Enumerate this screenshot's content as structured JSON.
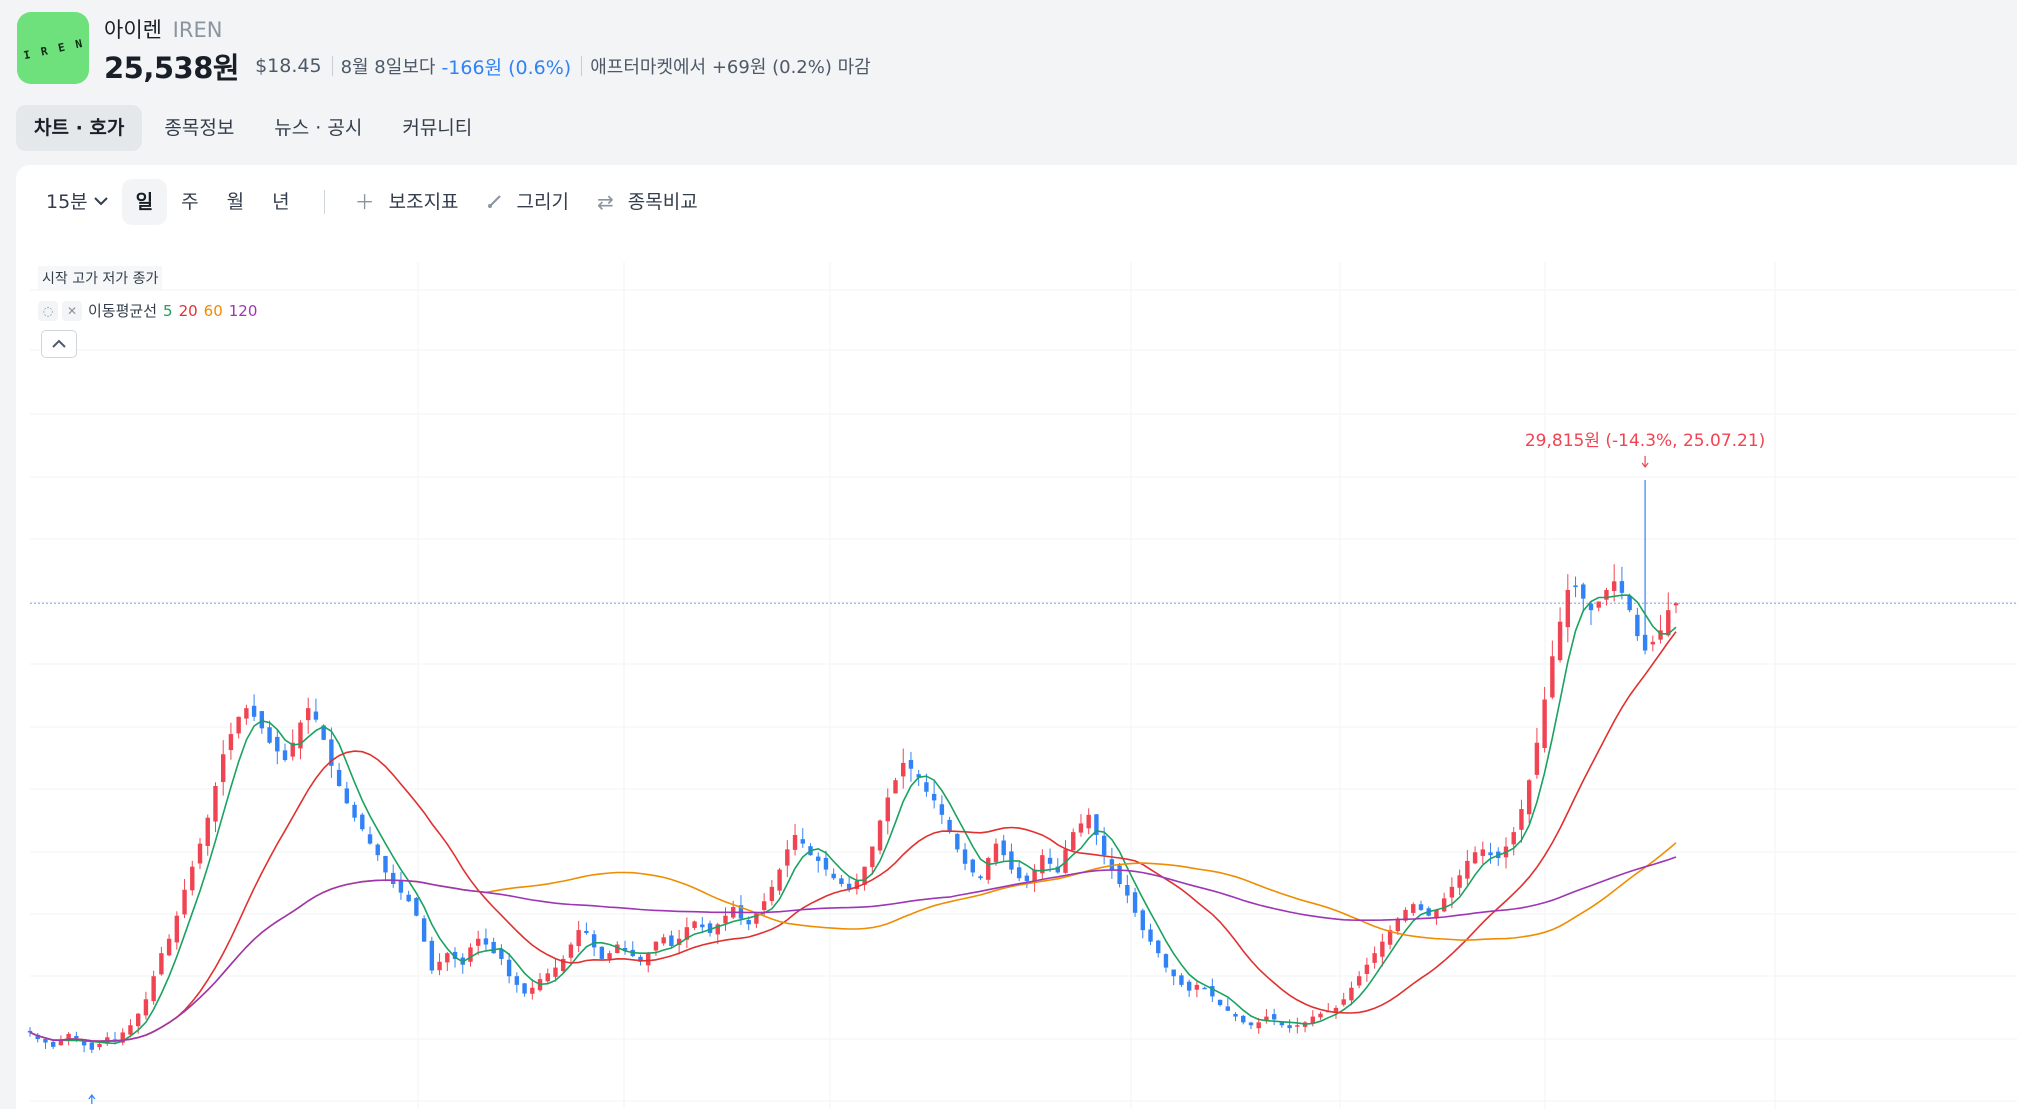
{
  "header": {
    "logo_text": "IREN",
    "name": "아이렌",
    "ticker": "IREN",
    "price": "25,538원",
    "usd": "$18.45",
    "compare_label": "8월 8일보다",
    "change": "-166원 (0.6%)",
    "after_market": "애프터마켓에서 +69원 (0.2%) 마감"
  },
  "tabs": [
    {
      "label": "차트 · 호가"
    },
    {
      "label": "종목정보"
    },
    {
      "label": "뉴스 · 공시"
    },
    {
      "label": "커뮤니티"
    }
  ],
  "toolbar": {
    "interval": "15분",
    "periods": [
      "일",
      "주",
      "월",
      "년"
    ],
    "indicator": "보조지표",
    "draw": "그리기",
    "compare": "종목비교"
  },
  "legend": {
    "ohlc": "시작 고가 저가 종가",
    "ma_label": "이동평균선",
    "ma": [
      {
        "period": "5",
        "color": "#1aa260"
      },
      {
        "period": "20",
        "color": "#e03131"
      },
      {
        "period": "60",
        "color": "#f08c00"
      },
      {
        "period": "120",
        "color": "#9c36b5"
      }
    ]
  },
  "colors": {
    "up": "#f04452",
    "down": "#3182f6",
    "accent": "#3182f6",
    "logo_bg": "#6ee07c"
  },
  "chart_data": {
    "type": "candlestick",
    "series_name": "IREN daily",
    "y_unit": "원",
    "closes": [
      10650,
      10420,
      10300,
      10150,
      10380,
      10600,
      10450,
      10200,
      10050,
      10250,
      10480,
      10350,
      10650,
      10900,
      11300,
      11800,
      12600,
      13400,
      13900,
      14700,
      15600,
      16400,
      17200,
      18100,
      19200,
      20300,
      21000,
      21600,
      21900,
      21600,
      21200,
      20700,
      20400,
      20100,
      20700,
      21400,
      21900,
      21500,
      20800,
      19900,
      19200,
      18600,
      18100,
      17700,
      17200,
      16800,
      16200,
      15800,
      15500,
      15200,
      14700,
      13800,
      12800,
      13100,
      13400,
      13200,
      13000,
      13600,
      13900,
      13700,
      13400,
      13200,
      12600,
      12300,
      12000,
      12200,
      12500,
      12700,
      12900,
      13200,
      13700,
      14200,
      14100,
      13600,
      13200,
      13400,
      13700,
      13500,
      13300,
      13100,
      13400,
      13800,
      13950,
      13650,
      13900,
      14300,
      14500,
      14300,
      14100,
      14400,
      14700,
      15000,
      14600,
      14400,
      14800,
      15200,
      15700,
      16300,
      17000,
      17500,
      17200,
      16800,
      16600,
      16300,
      16000,
      15800,
      15600,
      15900,
      16400,
      17100,
      18000,
      18800,
      19400,
      20000,
      19800,
      19500,
      19000,
      18700,
      18200,
      17600,
      17000,
      16500,
      16200,
      16000,
      16700,
      17200,
      16800,
      16300,
      16000,
      15900,
      16300,
      16800,
      16500,
      16200,
      17000,
      17600,
      17900,
      18200,
      17500,
      16800,
      16300,
      15800,
      15400,
      14800,
      14200,
      13800,
      13400,
      12900,
      12600,
      12300,
      12100,
      12300,
      12200,
      11900,
      11600,
      11400,
      11200,
      11000,
      10900,
      11000,
      11200,
      11100,
      10900,
      10800,
      10900,
      11000,
      11200,
      11300,
      11400,
      11500,
      11800,
      12200,
      12600,
      13000,
      13400,
      13800,
      14200,
      14600,
      14900,
      15100,
      14900,
      14700,
      14900,
      15300,
      15700,
      16100,
      16600,
      16900,
      17000,
      16800,
      16700,
      17100,
      17600,
      18400,
      19400,
      20700,
      22200,
      23700,
      24900,
      26000,
      26100,
      25700,
      25300,
      25600,
      26000,
      26300,
      25900,
      25300,
      24400,
      23900,
      24200,
      24600,
      25300,
      25538
    ],
    "highs_annotation": "29,815원 (-14.3%, 25.07.21)",
    "moving_averages": [
      "MA5",
      "MA20",
      "MA60",
      "MA120"
    ]
  }
}
